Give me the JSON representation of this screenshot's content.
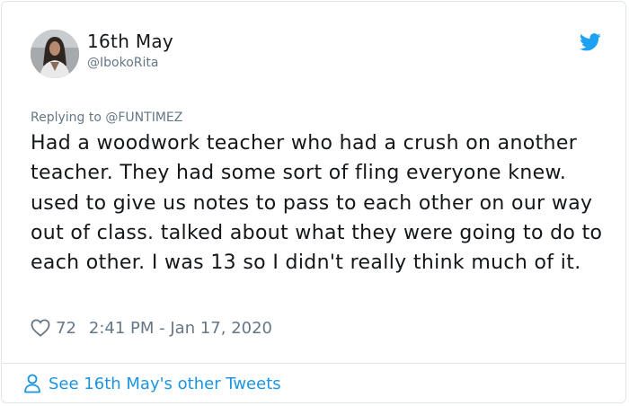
{
  "author": {
    "display_name": "16th May",
    "handle": "@IbokoRita",
    "avatar_icon": "profile-photo"
  },
  "tweet": {
    "replying_to": "Replying to @FUNTIMEZ",
    "text": "Had a woodwork teacher who had a crush on another teacher. They had some sort of fling everyone knew. used to give us notes to pass to each other on our way out of class. talked about what they were going to do to each other. I was 13 so I didn't really think much of it.",
    "likes": "72",
    "timestamp": "2:41 PM - Jan 17, 2020"
  },
  "footer": {
    "see_more_label": "See 16th May's other Tweets"
  },
  "colors": {
    "brand_blue": "#1da1f2",
    "link_blue": "#1b95e0",
    "secondary_text": "#657786",
    "border": "#e1e8ed"
  },
  "icons": {
    "brand": "twitter-bird-icon",
    "like": "heart-icon",
    "profile": "person-icon"
  }
}
